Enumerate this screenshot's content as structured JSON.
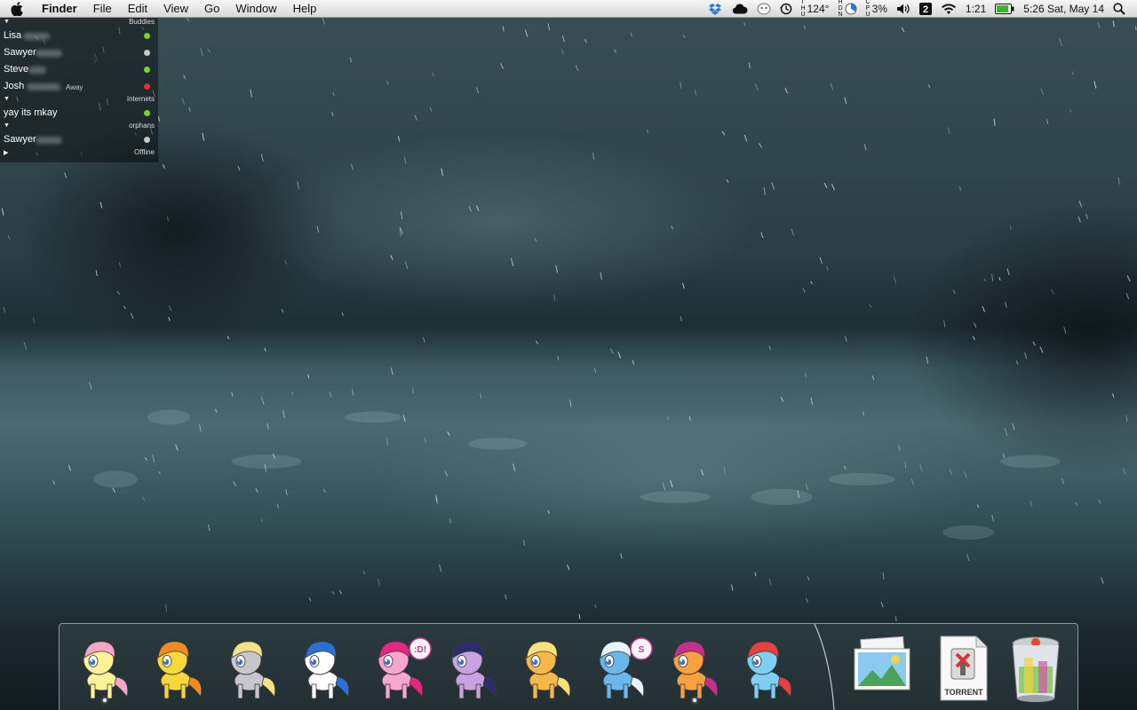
{
  "menubar": {
    "app_name": "Finder",
    "menus": [
      "File",
      "Edit",
      "View",
      "Go",
      "Window",
      "Help"
    ],
    "status": {
      "temperature": "124°",
      "percent": "3%",
      "battery_time": "1:21",
      "clock": "5:26 Sat, May 14",
      "tiny_labels": {
        "thu": [
          "T",
          "H",
          "U"
        ],
        "hdn": [
          "H",
          "D",
          "N"
        ],
        "cpu": [
          "C",
          "P",
          "U"
        ]
      },
      "extra_badge": "2"
    }
  },
  "buddy_list": {
    "groups": [
      {
        "name": "Buddies",
        "buddies": [
          {
            "name": "Lisa",
            "status_color": "#7fd22a",
            "away_label": ""
          },
          {
            "name": "Sawyer",
            "status_color": "#c8c8c8",
            "away_label": ""
          },
          {
            "name": "Steve",
            "status_color": "#7fd22a",
            "away_label": ""
          },
          {
            "name": "Josh",
            "status_color": "#e23030",
            "away_label": "Away"
          }
        ]
      },
      {
        "name": "Internets",
        "buddies": [
          {
            "name": "yay its mkay",
            "status_color": "#7fd22a",
            "away_label": ""
          }
        ]
      },
      {
        "name": "orphans",
        "buddies": [
          {
            "name": "Sawyer",
            "status_color": "#c8c8c8",
            "away_label": ""
          }
        ]
      },
      {
        "name": "Offline",
        "buddies": []
      }
    ]
  },
  "dock": {
    "apps": [
      {
        "name": "fluttershy-pony-icon",
        "body": "#fbf39a",
        "mane": "#f7a6c8",
        "running": true,
        "badge": ""
      },
      {
        "name": "spitfire-pony-icon",
        "body": "#f7d83a",
        "mane": "#f28b1e",
        "running": false,
        "badge": ""
      },
      {
        "name": "derpy-pony-icon",
        "body": "#c6c6cc",
        "mane": "#f3e28a",
        "running": false,
        "badge": ""
      },
      {
        "name": "vinyl-scratch-pony-icon",
        "body": "#ffffff",
        "mane": "#2a6fd6",
        "running": false,
        "badge": ""
      },
      {
        "name": "pinkie-pie-pony-icon",
        "body": "#f6a6cf",
        "mane": "#e6267f",
        "running": false,
        "badge": ":D!"
      },
      {
        "name": "twilight-sparkle-pony-icon",
        "body": "#c9a2e2",
        "mane": "#2b2d6e",
        "running": false,
        "badge": ""
      },
      {
        "name": "applejack-pony-icon",
        "body": "#f7b84a",
        "mane": "#f6e27a",
        "running": false,
        "badge": ""
      },
      {
        "name": "trixie-pony-icon",
        "body": "#6ab7ec",
        "mane": "#e9f3fb",
        "running": false,
        "badge": "S"
      },
      {
        "name": "scootaloo-pony-icon",
        "body": "#f7a23e",
        "mane": "#c72f8f",
        "running": true,
        "badge": ""
      },
      {
        "name": "rainbow-dash-pony-icon",
        "body": "#7dd0f3",
        "mane": "#ea3f3f",
        "running": false,
        "badge": ""
      }
    ],
    "stacks": [
      {
        "name": "pictures-stack-icon"
      },
      {
        "name": "torrent-document-icon",
        "label": "TORRENT"
      },
      {
        "name": "trash-icon"
      }
    ]
  }
}
